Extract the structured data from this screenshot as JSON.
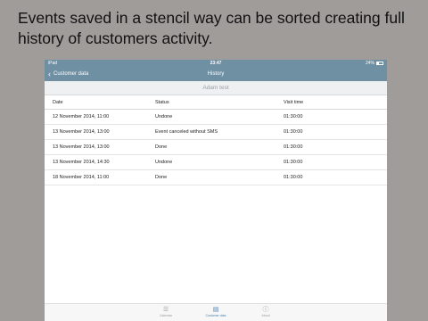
{
  "caption": "Events saved in a stencil way can be sorted creating full history of customers activity.",
  "status_bar": {
    "carrier": "iPad",
    "time": "23:47",
    "battery": "24%"
  },
  "nav": {
    "back_label": "Customer data",
    "title": "History"
  },
  "subtitle": "Adam test",
  "table": {
    "headers": [
      "Date",
      "Status",
      "Visit time"
    ],
    "rows": [
      [
        "12 November 2014, 11:00",
        "Undone",
        "01:30:00"
      ],
      [
        "13 November 2014, 13:00",
        "Event canceled without SMS",
        "01:30:00"
      ],
      [
        "13 November 2014, 13:00",
        "Done",
        "01:30:00"
      ],
      [
        "13 November 2014, 14:30",
        "Undone",
        "01:30:00"
      ],
      [
        "18 November 2014, 11:00",
        "Done",
        "01:30:00"
      ]
    ]
  },
  "tabs": [
    {
      "label": "Calendar",
      "icon": "list-icon"
    },
    {
      "label": "Customer data",
      "icon": "folder-icon"
    },
    {
      "label": "About",
      "icon": "info-icon"
    }
  ],
  "colors": {
    "navbar": "#6f8fa3",
    "active_tab": "#4a7fb5",
    "background": "#a09c9a"
  }
}
